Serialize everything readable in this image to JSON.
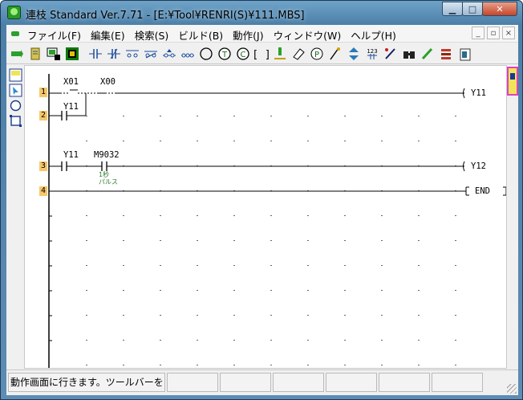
{
  "window": {
    "title": "連枝 Standard Ver.7.71 - [E:¥Tool¥RENRI(S)¥111.MBS]",
    "caption_buttons": [
      "minimize",
      "maximize",
      "close"
    ]
  },
  "menu": {
    "items": [
      "ファイル(F)",
      "編集(E)",
      "検索(S)",
      "ビルド(B)",
      "動作(J)",
      "ウィンドウ(W)",
      "ヘルプ(H)"
    ],
    "mdi_buttons": [
      "_",
      "▫",
      "×"
    ]
  },
  "toolbar": {
    "buttons": [
      "run-mode-icon",
      "edit-mode-icon",
      "monitor-icon",
      "stop-icon",
      "contact-no-icon",
      "contact-nc-icon",
      "contact-parallel-no-icon",
      "contact-parallel-nc-icon",
      "contact-rise-icon",
      "contact-fall-icon",
      "coil-icon",
      "timer-icon",
      "counter-icon",
      "instruction-icon",
      "output-icon",
      "eraser-icon",
      "pulse-icon",
      "line-draw-icon",
      "scroll-updown-icon",
      "number-icon",
      "pen-icon",
      "find-icon",
      "pencil-green-icon",
      "stack-icon",
      "device-list-icon"
    ]
  },
  "ladder": {
    "rungs": [
      {
        "number": "1",
        "contacts": [
          {
            "label": "X01",
            "type": "rise"
          },
          {
            "label": "X00",
            "type": "rise"
          }
        ],
        "coil": "Y11"
      },
      {
        "number": "2",
        "contacts": [
          {
            "label": "Y11",
            "type": "no"
          }
        ],
        "coil": ""
      },
      {
        "number": "3",
        "contacts": [
          {
            "label": "Y11",
            "type": "no"
          },
          {
            "label": "M9032",
            "type": "no"
          }
        ],
        "coil": "Y12",
        "comment_line1": "1秒",
        "comment_line2": "パルス"
      },
      {
        "number": "4",
        "contacts": [],
        "coil": "END"
      }
    ]
  },
  "status": {
    "message": "動作画面に行きます。ツールバーを"
  },
  "colors": {
    "rung_number_bg": "#f6c86a",
    "comment_text": "#2a7a2a",
    "title_bar": "#4c7fa8"
  }
}
